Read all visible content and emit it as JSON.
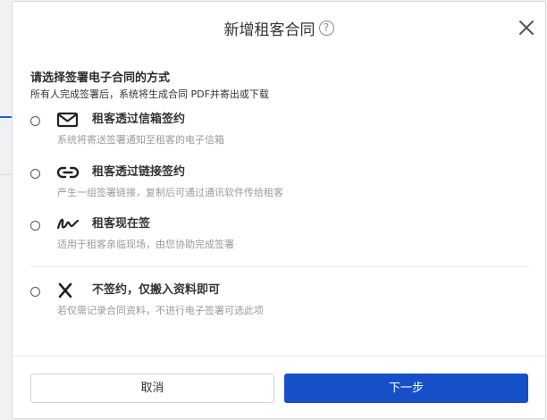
{
  "dialog": {
    "title": "新增租客合同",
    "help_icon": "?"
  },
  "section": {
    "title": "请选择签署电子合同的方式",
    "subtitle": "所有人完成签署后，系统将生成合同 PDF并寄出或下载"
  },
  "options": [
    {
      "icon": "envelope-icon",
      "label": "租客透过信箱签约",
      "desc": "系统将寄送签署通知至租客的电子信箱"
    },
    {
      "icon": "link-icon",
      "label": "租客透过链接签约",
      "desc": "产生一组签署链接，复制后可通过通讯软件传给租客"
    },
    {
      "icon": "signature-icon",
      "label": "租客现在签",
      "desc": "适用于租客亲临现场，由您协助完成签署"
    },
    {
      "icon": "x-mark-icon",
      "label": "不签约，仅搬入资料即可",
      "desc": "若仅需记录合同资料，不进行电子签署可选此项"
    }
  ],
  "footer": {
    "cancel_label": "取消",
    "next_label": "下一步"
  },
  "colors": {
    "primary": "#1650c8",
    "text": "#333333",
    "muted": "#9a9a9a"
  }
}
